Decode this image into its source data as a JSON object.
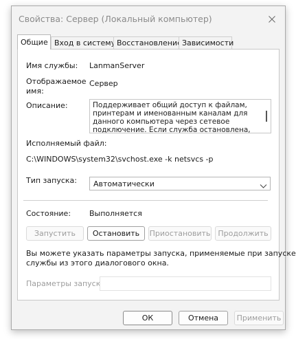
{
  "window": {
    "title": "Свойства: Сервер (Локальный компьютер)"
  },
  "tabs": [
    {
      "label": "Общие",
      "active": true
    },
    {
      "label": "Вход в систему",
      "active": false
    },
    {
      "label": "Восстановление",
      "active": false
    },
    {
      "label": "Зависимости",
      "active": false
    }
  ],
  "general": {
    "service_name_label": "Имя службы:",
    "service_name": "LanmanServer",
    "display_name_label_1": "Отображаемое",
    "display_name_label_2": "имя:",
    "display_name": "Сервер",
    "description_label": "Описание:",
    "description_lines": [
      "Поддерживает общий доступ к файлам,",
      "принтерам и именованным каналам для",
      "данного компьютера через сетевое",
      "подключение. Если служба остановлена, такие"
    ],
    "exe_label": "Исполняемый файл:",
    "exe_path": "C:\\WINDOWS\\system32\\svchost.exe -k netsvcs -p",
    "startup_type_label": "Тип запуска:",
    "startup_type_value": "Автоматически",
    "status_label": "Состояние:",
    "status_value": "Выполняется",
    "buttons": {
      "start": "Запустить",
      "stop": "Остановить",
      "pause": "Приостановить",
      "resume": "Продолжить"
    },
    "hint_line_1": "Вы можете указать параметры запуска, применяемые при запуске",
    "hint_line_2": "службы из этого диалогового окна.",
    "start_params_label": "Параметры запуска:",
    "start_params_value": ""
  },
  "footer": {
    "ok": "ОК",
    "cancel": "Отмена",
    "apply": "Применить"
  },
  "icons": {
    "close": "close-icon",
    "dropdown": "chevron-down-icon"
  }
}
